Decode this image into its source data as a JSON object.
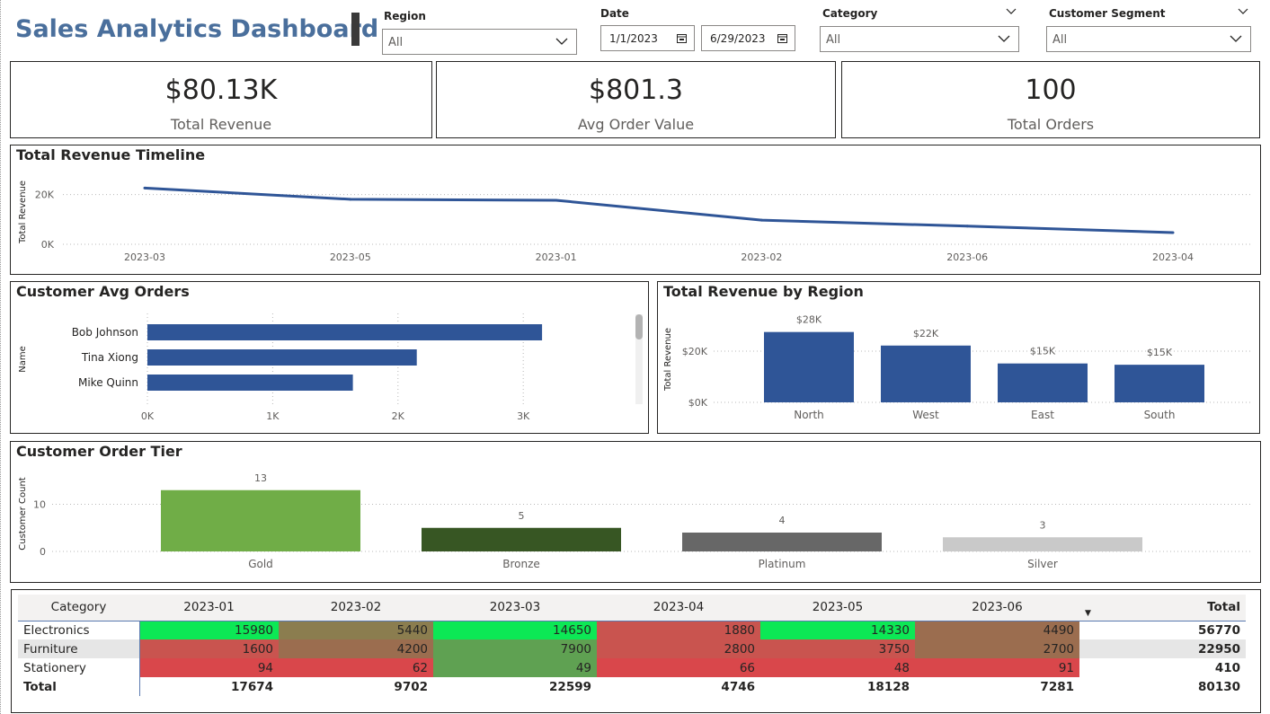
{
  "header": {
    "title": "Sales Analytics Dashboard"
  },
  "slicers": {
    "region": {
      "label": "Region",
      "value": "All"
    },
    "date": {
      "label": "Date",
      "start": "1/1/2023",
      "end": "6/29/2023"
    },
    "category": {
      "label": "Category",
      "value": "All"
    },
    "segment": {
      "label": "Customer Segment",
      "value": "All"
    }
  },
  "cards": [
    {
      "value": "$80.13K",
      "label": "Total Revenue"
    },
    {
      "value": "$801.3",
      "label": "Avg Order Value"
    },
    {
      "value": "100",
      "label": "Total Orders"
    }
  ],
  "colors": {
    "accent_blue": "#2f5597",
    "title_blue": "#4a6f9c",
    "tier_gold": "#70ad47",
    "tier_bronze": "#375623",
    "tier_platinum": "#676767",
    "tier_silver": "#c9c9c9",
    "cell_green": "#0ce855",
    "cell_olive": "#8b7d4f",
    "cell_midgreen": "#5fa152",
    "cell_red": "#d9474b",
    "cell_lightred": "#c9544f",
    "cell_brown": "#9b6d4f"
  },
  "chart_data": [
    {
      "type": "line",
      "title": "Total Revenue Timeline",
      "xlabel": "",
      "ylabel": "Total Revenue",
      "categories": [
        "2023-03",
        "2023-05",
        "2023-01",
        "2023-02",
        "2023-06",
        "2023-04"
      ],
      "values": [
        22600,
        18100,
        17700,
        9700,
        7300,
        4700
      ],
      "yticks": [
        "0K",
        "20K"
      ],
      "ylim": [
        0,
        26000
      ],
      "grid": true
    },
    {
      "type": "bar",
      "orientation": "horizontal",
      "title": "Customer Avg Orders",
      "ylabel": "Name",
      "categories": [
        "Bob Johnson",
        "Tina Xiong",
        "Mike Quinn"
      ],
      "values": [
        3150,
        2150,
        1640
      ],
      "xticks": [
        "0K",
        "1K",
        "2K",
        "3K"
      ],
      "xlim": [
        0,
        3300
      ],
      "grid": true
    },
    {
      "type": "bar",
      "title": "Total Revenue by Region",
      "ylabel": "Total Revenue",
      "categories": [
        "North",
        "West",
        "East",
        "South"
      ],
      "values": [
        27500,
        22200,
        15200,
        14700
      ],
      "data_labels": [
        "$28K",
        "$22K",
        "$15K",
        "$15K"
      ],
      "yticks": [
        "$0K",
        "$20K"
      ],
      "ylim": [
        0,
        33000
      ],
      "grid": true
    },
    {
      "type": "bar",
      "title": "Customer Order Tier",
      "ylabel": "Customer Count",
      "categories": [
        "Gold",
        "Bronze",
        "Platinum",
        "Silver"
      ],
      "values": [
        13,
        5,
        4,
        3
      ],
      "data_labels": [
        "13",
        "5",
        "4",
        "3"
      ],
      "yticks": [
        "0",
        "10"
      ],
      "ylim": [
        0,
        16
      ],
      "grid": true
    }
  ],
  "matrix": {
    "headers": [
      "Category",
      "2023-01",
      "2023-02",
      "2023-03",
      "2023-04",
      "2023-05",
      "2023-06",
      "Total"
    ],
    "rows": [
      {
        "category": "Electronics",
        "values": [
          "15980",
          "5440",
          "14650",
          "1880",
          "14330",
          "4490"
        ],
        "total": "56770"
      },
      {
        "category": "Furniture",
        "values": [
          "1600",
          "4200",
          "7900",
          "2800",
          "3750",
          "2700"
        ],
        "total": "22950"
      },
      {
        "category": "Stationery",
        "values": [
          "94",
          "62",
          "49",
          "66",
          "48",
          "91"
        ],
        "total": "410"
      }
    ],
    "total_row": {
      "label": "Total",
      "values": [
        "17674",
        "9702",
        "22599",
        "4746",
        "18128",
        "7281"
      ],
      "total": "80130"
    }
  }
}
